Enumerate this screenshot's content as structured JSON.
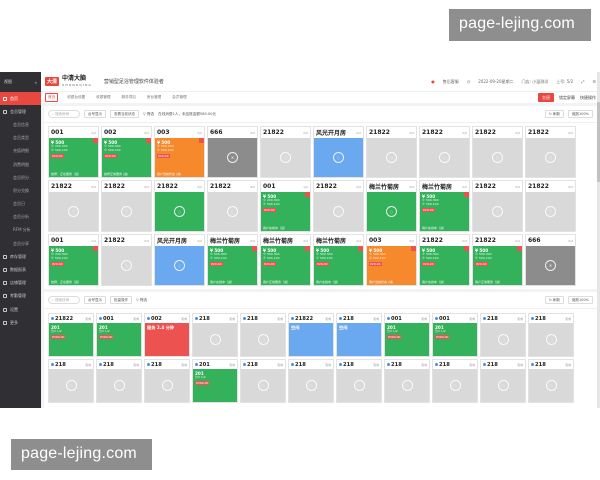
{
  "watermark": "page-lejing.com",
  "sidebar": {
    "top_label": "视图",
    "collapse_icon": "double-chevron-left-icon",
    "items": [
      {
        "label": "首页",
        "sub": false,
        "active": true
      },
      {
        "label": "会员管理",
        "sub": false,
        "active": false
      },
      {
        "label": "会员信息",
        "sub": true,
        "active": false
      },
      {
        "label": "会员类型",
        "sub": true,
        "active": false
      },
      {
        "label": "充值明细",
        "sub": true,
        "active": false
      },
      {
        "label": "消费明细",
        "sub": true,
        "active": false
      },
      {
        "label": "会员积分",
        "sub": true,
        "active": false
      },
      {
        "label": "积分兑换",
        "sub": true,
        "active": false
      },
      {
        "label": "会员日",
        "sub": true,
        "active": false
      },
      {
        "label": "会员分析",
        "sub": true,
        "active": false
      },
      {
        "label": "RFM 分析",
        "sub": true,
        "active": false
      },
      {
        "label": "会员分享",
        "sub": true,
        "active": false
      },
      {
        "label": "库存管理",
        "sub": false,
        "active": false
      },
      {
        "label": "数据报表",
        "sub": false,
        "active": false
      },
      {
        "label": "店铺管理",
        "sub": false,
        "active": false
      },
      {
        "label": "考勤管理",
        "sub": false,
        "active": false
      },
      {
        "label": "设置",
        "sub": false,
        "active": false
      },
      {
        "label": "更多",
        "sub": false,
        "active": false
      }
    ]
  },
  "header": {
    "logo_box": "大清",
    "logo_text": "中清大脑",
    "logo_sub": "ZHONGQING",
    "title": "营销型足浴管理软件体验者",
    "notice": "售后客服",
    "date": "2022-09-20星期二",
    "store": "门店: 小温测试",
    "user": "上号: 5/2",
    "expand_icon": "fullscreen-icon",
    "menu_icon": "menu-icon"
  },
  "tabs": {
    "items": [
      "首页",
      "收银台设置",
      "收银管理",
      "服务项目",
      "房台管理",
      "会员管理"
    ],
    "active_index": 0,
    "btn_red": "交班",
    "btn_plain": "锁定屏幕",
    "btn_more": "快捷操作"
  },
  "panel1": {
    "search_placeholder": "搜索房间",
    "btn_a": "台号显示",
    "btn_b": "查看当前状态",
    "filter": "筛选",
    "stats": "在线消费1人，未结账金额580.00元",
    "refresh": "刷新",
    "zoom": "缩放100%"
  },
  "panel2": {
    "search_placeholder": "搜索技师",
    "btn_a": "台号显示",
    "btn_b": "批量操作",
    "filter": "筛选",
    "refresh": "刷新",
    "zoom": "缩放100%"
  },
  "rooms": [
    {
      "name": "001",
      "cap": "1/2",
      "color": "green",
      "lines": [
        "¥ 500",
        "© 200-300",
        "© 500-100"
      ],
      "badge": "¥20.00",
      "foot": "技师：正在服务（运）"
    },
    {
      "name": "002",
      "cap": "2/2",
      "color": "green",
      "lines": [
        "¥ 500",
        "© 500-300",
        "© 500-100"
      ],
      "badge": "¥20.00",
      "foot": "技师正常服务 (进)"
    },
    {
      "name": "003",
      "cap": "2/2",
      "color": "orange",
      "lines": [
        "¥ 500",
        "© 500-300",
        "© 500-100"
      ],
      "badge": "¥20.00",
      "foot": "用户当前状态 (消)"
    },
    {
      "name": "666",
      "cap": "2/2",
      "color": "darkgrey",
      "lines": [],
      "badge": "",
      "foot": ""
    },
    {
      "name": "21822",
      "cap": "2/2",
      "color": "grey",
      "lines": [],
      "badge": "",
      "foot": ""
    },
    {
      "name": "风光开月房",
      "cap": "2/2",
      "color": "blue",
      "lines": [],
      "badge": "",
      "foot": ""
    },
    {
      "name": "21822",
      "cap": "2/2",
      "color": "grey",
      "lines": [],
      "badge": "",
      "foot": ""
    },
    {
      "name": "21822",
      "cap": "2/2",
      "color": "grey",
      "lines": [],
      "badge": "",
      "foot": ""
    },
    {
      "name": "21822",
      "cap": "2/2",
      "color": "grey",
      "lines": [],
      "badge": "",
      "foot": ""
    },
    {
      "name": "21822",
      "cap": "2/2",
      "color": "grey",
      "lines": [],
      "badge": "",
      "foot": ""
    },
    {
      "name": "21822",
      "cap": "2/2",
      "color": "grey",
      "lines": [],
      "badge": "",
      "foot": ""
    },
    {
      "name": "21822",
      "cap": "2/2",
      "color": "grey",
      "lines": [],
      "badge": "",
      "foot": ""
    },
    {
      "name": "21822",
      "cap": "2/2",
      "color": "green",
      "lines": [],
      "badge": "",
      "foot": ""
    },
    {
      "name": "21822",
      "cap": "2/2",
      "color": "grey",
      "lines": [],
      "badge": "",
      "foot": ""
    },
    {
      "name": "001",
      "cap": "1/2",
      "color": "green",
      "lines": [
        "¥ 500",
        "© 200-300",
        "© 500-100"
      ],
      "badge": "¥20.00",
      "foot": "用户在线中（运）"
    },
    {
      "name": "21822",
      "cap": "2/2",
      "color": "grey",
      "lines": [],
      "badge": "",
      "foot": ""
    },
    {
      "name": "梅兰竹菊房",
      "cap": "2/2",
      "color": "green",
      "lines": [],
      "badge": "",
      "foot": ""
    },
    {
      "name": "梅兰竹菊房",
      "cap": "2/2",
      "color": "green",
      "lines": [
        "¥ 500",
        "© 500-300",
        "© 500-100"
      ],
      "badge": "¥20.00",
      "foot": "用户在线中（进）"
    },
    {
      "name": "21822",
      "cap": "2/2",
      "color": "grey",
      "lines": [],
      "badge": "",
      "foot": ""
    },
    {
      "name": "21822",
      "cap": "2/2",
      "color": "grey",
      "lines": [],
      "badge": "",
      "foot": ""
    },
    {
      "name": "001",
      "cap": "1/2",
      "color": "green",
      "lines": [
        "¥ 500",
        "© 200-300",
        "© 500-100"
      ],
      "badge": "¥20.00",
      "foot": "技师：正在服务（运）"
    },
    {
      "name": "21822",
      "cap": "2/2",
      "color": "grey",
      "lines": [],
      "badge": "",
      "foot": ""
    },
    {
      "name": "风光开月房",
      "cap": "2/2",
      "color": "blue",
      "lines": [],
      "badge": "",
      "foot": ""
    },
    {
      "name": "梅兰竹菊房",
      "cap": "2/2",
      "color": "green",
      "lines": [
        "¥ 500",
        "© 500-300",
        "© 500-100"
      ],
      "badge": "¥20.00",
      "foot": "用户在线中（进）"
    },
    {
      "name": "梅兰竹菊房",
      "cap": "2/2",
      "color": "green",
      "lines": [
        "¥ 500",
        "© 500-300",
        "© 500-100"
      ],
      "badge": "¥20.00",
      "foot": "用户正常服务（进）"
    },
    {
      "name": "梅兰竹菊房",
      "cap": "2/2",
      "color": "green",
      "lines": [
        "¥ 500",
        "© 500-300",
        "© 500-100"
      ],
      "badge": "¥20.00",
      "foot": "用户在线中（进）"
    },
    {
      "name": "003",
      "cap": "2/2",
      "color": "orange",
      "lines": [
        "¥ 500",
        "© 500-300",
        "© 500-100"
      ],
      "badge": "¥20.00",
      "foot": "用户当前状态 (消)"
    },
    {
      "name": "21822",
      "cap": "2/2",
      "color": "green",
      "lines": [
        "¥ 500",
        "© 500-300",
        "© 500-100"
      ],
      "badge": "¥20.00",
      "foot": "用户在线中（进）"
    },
    {
      "name": "21822",
      "cap": "2/2",
      "color": "green",
      "lines": [
        "¥ 500",
        "© 500-300",
        "© 500-100"
      ],
      "badge": "¥20.00",
      "foot": "用户正常服务（进）"
    },
    {
      "name": "666",
      "cap": "2/2",
      "color": "darkgrey",
      "lines": [],
      "badge": "",
      "foot": ""
    }
  ],
  "techs": [
    {
      "name": "21822",
      "cap": "轮岗",
      "color": "green",
      "lines": [
        "201",
        "分2 1/2"
      ],
      "badge": "¥300.00",
      "foot": "",
      "user": true
    },
    {
      "name": "001",
      "cap": "轮岗",
      "color": "green",
      "lines": [
        "201",
        "分2 1/2"
      ],
      "badge": "¥300.00",
      "foot": "",
      "user": true
    },
    {
      "name": "002",
      "cap": "轮岗",
      "color": "red",
      "lines": [
        "服务 2.4 分钟"
      ],
      "badge": "",
      "foot": "",
      "user": true
    },
    {
      "name": "218",
      "cap": "轮岗",
      "color": "grey",
      "lines": [],
      "badge": "",
      "foot": "",
      "user": true
    },
    {
      "name": "218",
      "cap": "轮岗",
      "color": "grey",
      "lines": [],
      "badge": "",
      "foot": "",
      "user": true
    },
    {
      "name": "21822",
      "cap": "轮岗",
      "color": "blue",
      "lines": [
        "空闲"
      ],
      "badge": "",
      "foot": "",
      "user": true
    },
    {
      "name": "218",
      "cap": "轮岗",
      "color": "blue",
      "lines": [
        "空闲"
      ],
      "badge": "",
      "foot": "",
      "user": true
    },
    {
      "name": "001",
      "cap": "轮岗",
      "color": "green",
      "lines": [
        "201",
        "分2 1/2"
      ],
      "badge": "¥300.00",
      "foot": "",
      "user": true
    },
    {
      "name": "001",
      "cap": "轮岗",
      "color": "green",
      "lines": [
        "201",
        "分2 1/2"
      ],
      "badge": "¥300.00",
      "foot": "",
      "user": true
    },
    {
      "name": "218",
      "cap": "轮岗",
      "color": "grey",
      "lines": [],
      "badge": "",
      "foot": "",
      "user": true
    },
    {
      "name": "218",
      "cap": "轮岗",
      "color": "grey",
      "lines": [],
      "badge": "",
      "foot": "",
      "user": true
    },
    {
      "name": "218",
      "cap": "轮岗",
      "color": "grey",
      "lines": [],
      "badge": "",
      "foot": "",
      "user": true
    },
    {
      "name": "218",
      "cap": "轮岗",
      "color": "grey",
      "lines": [],
      "badge": "",
      "foot": "",
      "user": true
    },
    {
      "name": "218",
      "cap": "轮岗",
      "color": "grey",
      "lines": [],
      "badge": "",
      "foot": "",
      "user": true
    },
    {
      "name": "201",
      "cap": "轮岗",
      "color": "green",
      "lines": [
        "201",
        "分2 1/2"
      ],
      "badge": "¥300.00",
      "foot": "",
      "user": true
    },
    {
      "name": "218",
      "cap": "轮岗",
      "color": "grey",
      "lines": [],
      "badge": "",
      "foot": "",
      "user": true
    },
    {
      "name": "218",
      "cap": "轮岗",
      "color": "grey",
      "lines": [],
      "badge": "",
      "foot": "",
      "user": true
    },
    {
      "name": "218",
      "cap": "轮岗",
      "color": "grey",
      "lines": [],
      "badge": "",
      "foot": "",
      "user": true
    },
    {
      "name": "218",
      "cap": "轮岗",
      "color": "grey",
      "lines": [],
      "badge": "",
      "foot": "",
      "user": true
    },
    {
      "name": "218",
      "cap": "轮岗",
      "color": "grey",
      "lines": [],
      "badge": "",
      "foot": "",
      "user": true
    },
    {
      "name": "218",
      "cap": "轮岗",
      "color": "grey",
      "lines": [],
      "badge": "",
      "foot": "",
      "user": true
    },
    {
      "name": "218",
      "cap": "轮岗",
      "color": "grey",
      "lines": [],
      "badge": "",
      "foot": "",
      "user": true
    }
  ],
  "colors": {
    "accent": "#e8483f",
    "green": "#34b25b",
    "orange": "#f5892b",
    "blue": "#6aa8f0",
    "grey": "#d9d9d9",
    "darkgrey": "#8c8c8c",
    "sidebar": "#2f2f34"
  }
}
